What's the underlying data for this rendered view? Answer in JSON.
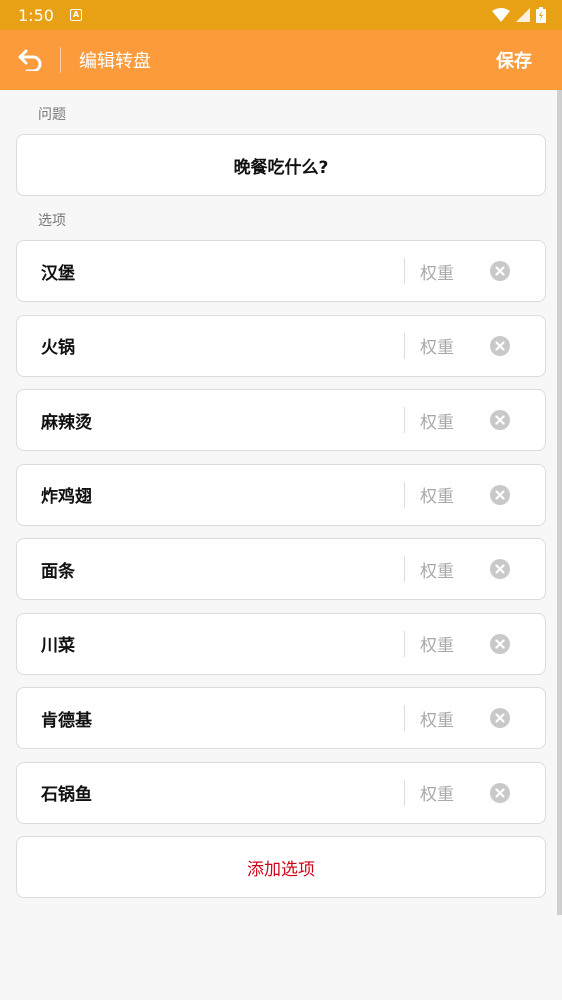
{
  "status": {
    "time": "1:50",
    "notif_glyph": "A"
  },
  "app_bar": {
    "title": "编辑转盘",
    "save_label": "保存"
  },
  "question": {
    "label": "问题",
    "value": "晚餐吃什么?"
  },
  "options": {
    "label": "选项",
    "weight_placeholder": "权重",
    "items": [
      {
        "name": "汉堡"
      },
      {
        "name": "火锅"
      },
      {
        "name": "麻辣烫"
      },
      {
        "name": "炸鸡翅"
      },
      {
        "name": "面条"
      },
      {
        "name": "川菜"
      },
      {
        "name": "肯德基"
      },
      {
        "name": "石锅鱼"
      }
    ]
  },
  "add_option_label": "添加选项",
  "colors": {
    "status_bar": "#e8a114",
    "app_bar": "#fb9b3c",
    "add_text": "#d0021b"
  }
}
